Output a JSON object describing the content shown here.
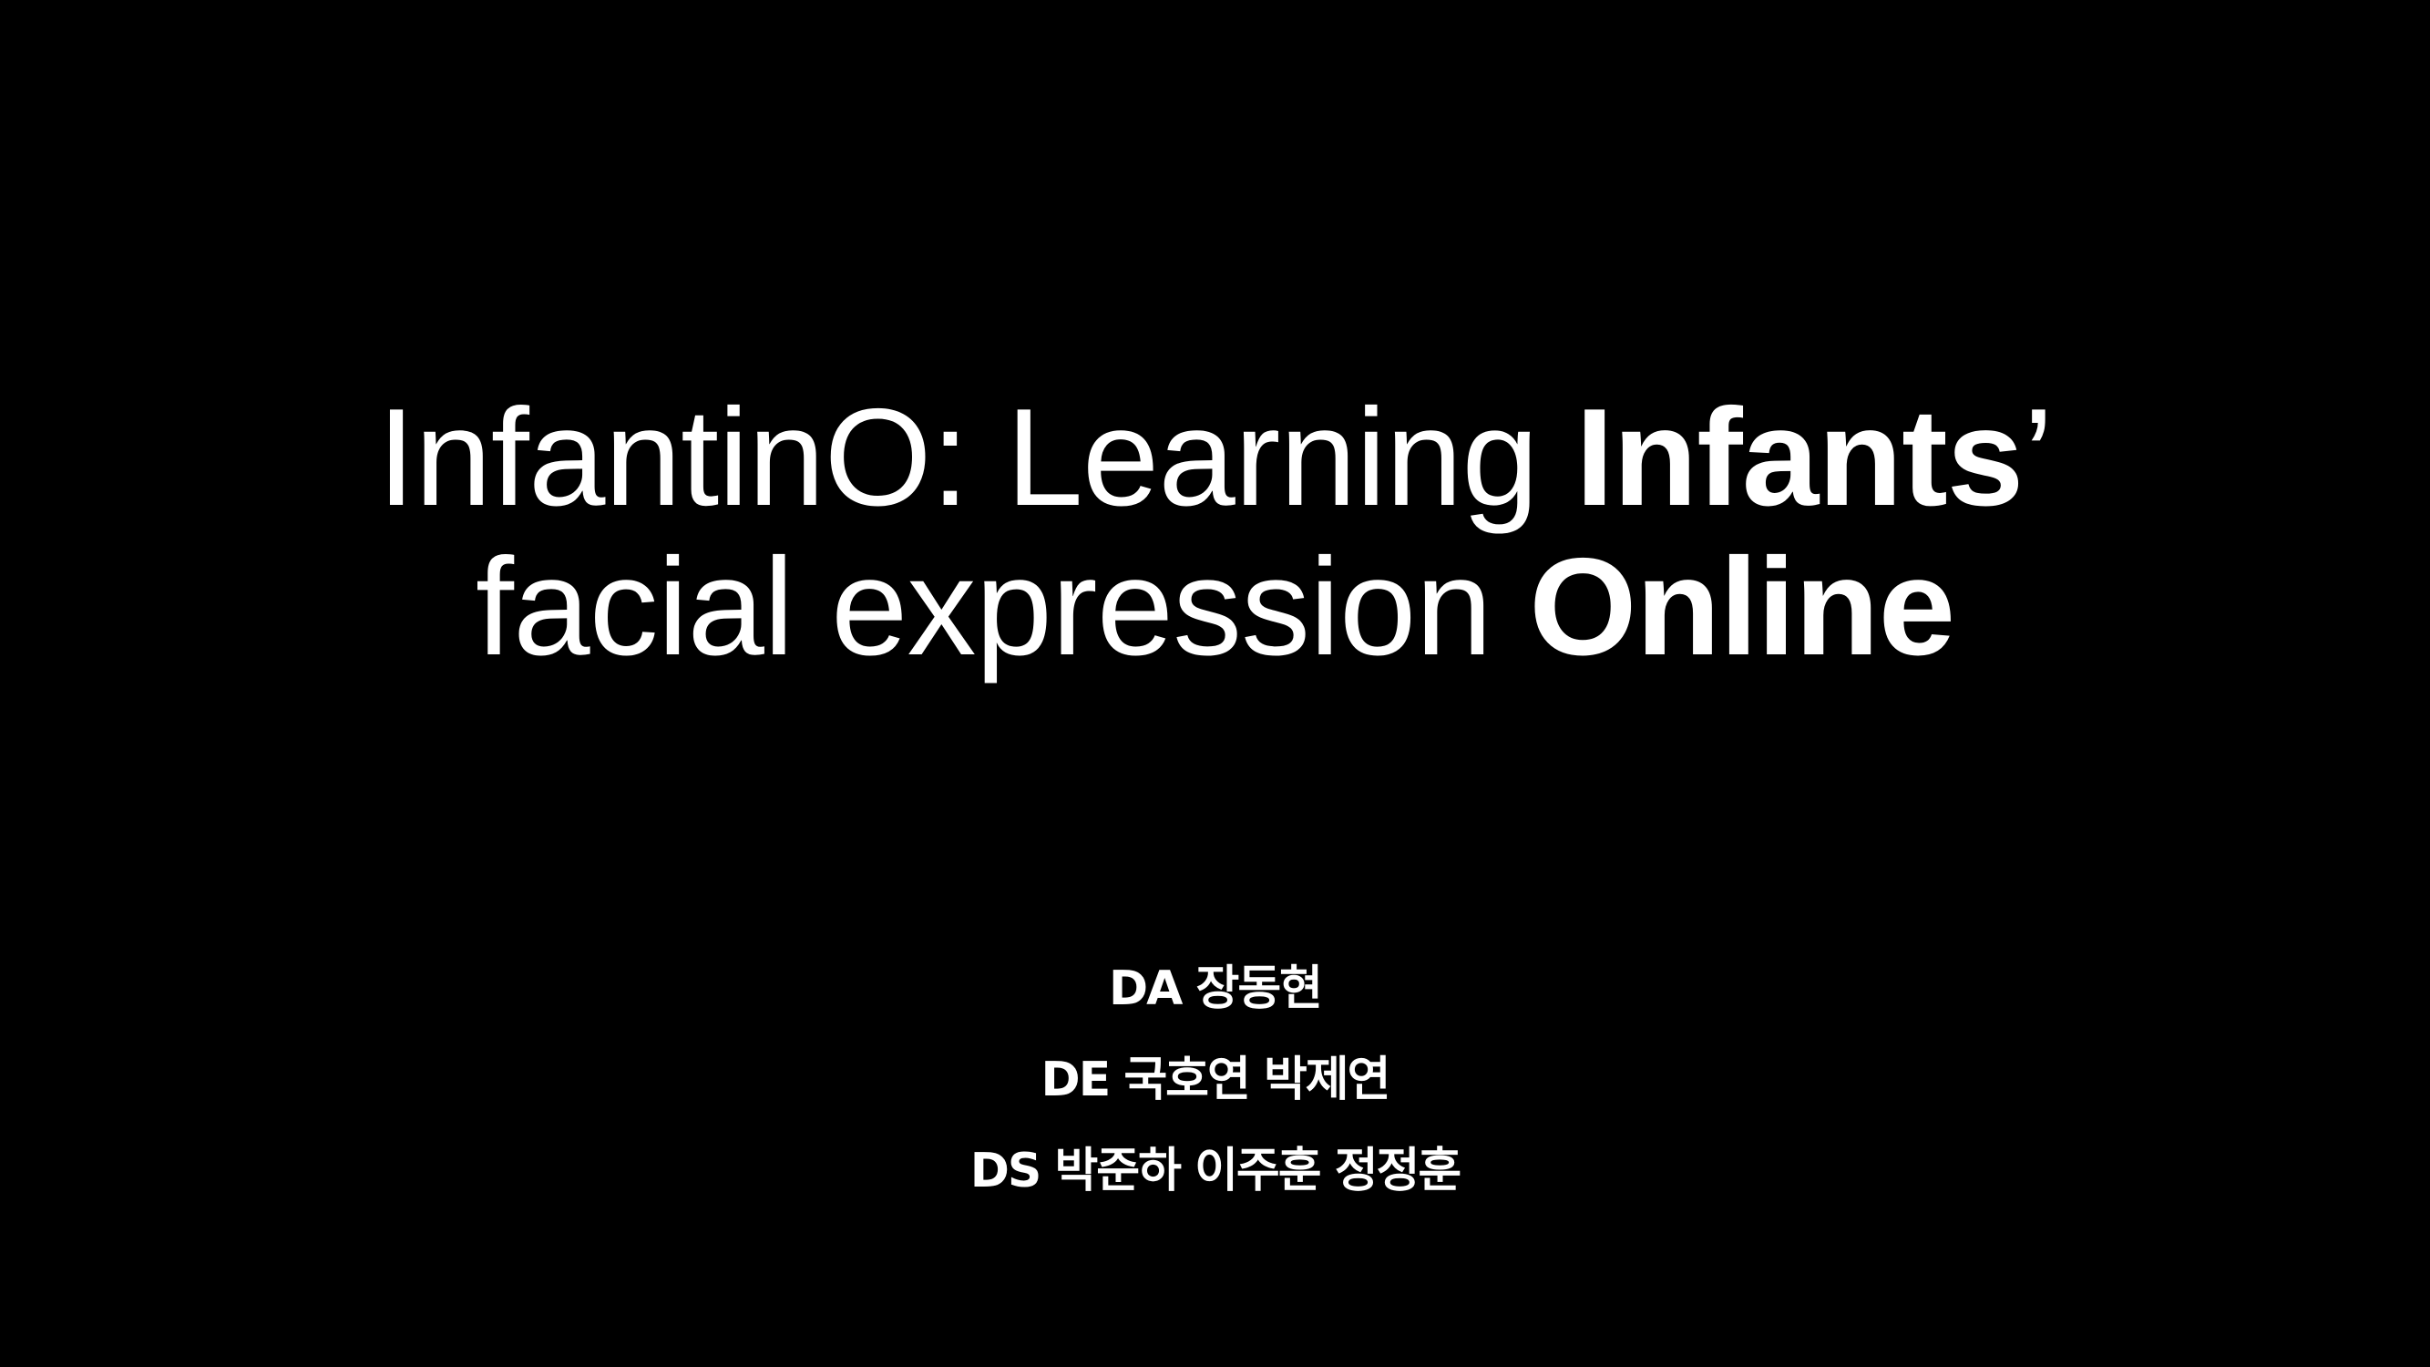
{
  "slide": {
    "background": "#000000",
    "text_color": "#ffffff",
    "title": {
      "line1": {
        "regular": "InfantinO: Learning ",
        "bold": "Infants",
        "tail": "’"
      },
      "line2": {
        "regular": "facial expression ",
        "bold": "Online"
      }
    },
    "authors": [
      "DA 장동현",
      "DE 국호연 박제연",
      "DS 박준하 이주훈 정정훈"
    ]
  }
}
